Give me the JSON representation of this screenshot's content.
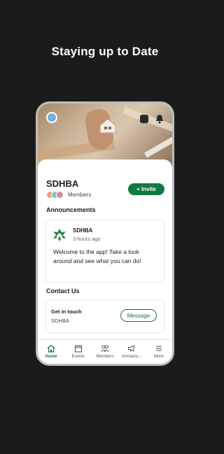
{
  "page": {
    "headline": "Staying up to Date"
  },
  "org": {
    "name": "SDHBA",
    "members_label": "Members",
    "invite_label": "+ Invite"
  },
  "announcements": {
    "section_title": "Announcements",
    "post": {
      "author": "SDHBA",
      "time": "3 hours ago",
      "body": "Welcome to the app! Take a look around and see what you can do!"
    }
  },
  "contact": {
    "section_title": "Contact Us",
    "title": "Get in touch",
    "subtitle": "SDHBA",
    "message_label": "Message"
  },
  "tabs": [
    {
      "label": "Home",
      "icon": "home-icon",
      "active": true
    },
    {
      "label": "Events",
      "icon": "calendar-icon",
      "active": false
    },
    {
      "label": "Members",
      "icon": "members-icon",
      "active": false
    },
    {
      "label": "Announc...",
      "icon": "megaphone-icon",
      "active": false
    },
    {
      "label": "More",
      "icon": "menu-icon",
      "active": false
    }
  ],
  "colors": {
    "brand": "#0f7a43",
    "background": "#1b1b1b"
  }
}
